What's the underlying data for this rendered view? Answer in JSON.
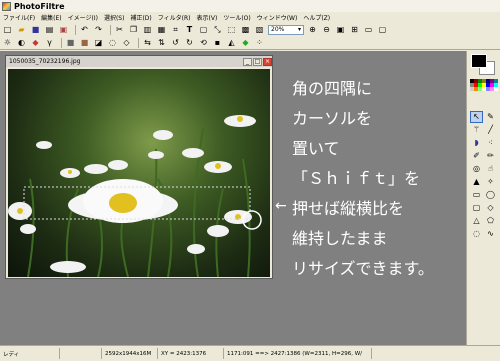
{
  "app": {
    "title": "PhotoFiltre"
  },
  "menu": [
    "ファイル(F)",
    "編集(E)",
    "イメージ(I)",
    "選択(S)",
    "補正(D)",
    "フィルタ(R)",
    "表示(V)",
    "ツール(O)",
    "ウィンドウ(W)",
    "ヘルプ(Z)"
  ],
  "toolbar": {
    "zoom_value": "20%"
  },
  "document": {
    "filename": "1050035_70232196.jpg"
  },
  "annotation": {
    "lines": [
      "角の四隅に",
      "カーソルを",
      "置いて",
      "「Ｓｈｉｆｔ」を",
      "押せば縦横比を",
      "維持したまま",
      "リサイズできます。"
    ],
    "arrow": "←"
  },
  "status": {
    "ready": "レディ",
    "image_info": "2592x1944x16M",
    "coords": "XY = 2423:1376",
    "selection": "1171:091 ==> 2427:1386 (W=2311, H=296, W/"
  },
  "colors": {
    "foreground": "#000000",
    "background": "#ffffff"
  }
}
